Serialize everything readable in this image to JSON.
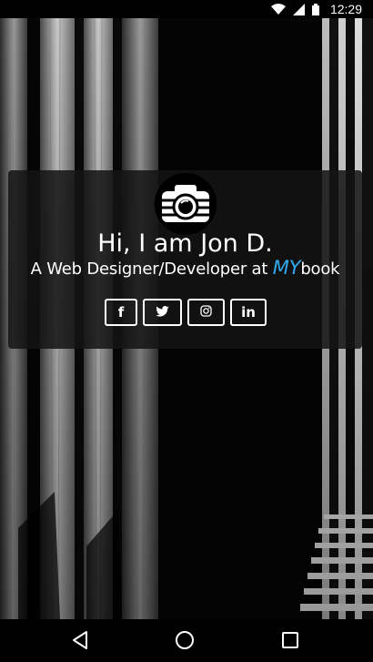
{
  "status_bar": {
    "time": "12:29",
    "icons": [
      "wifi-icon",
      "signal-icon",
      "battery-icon"
    ]
  },
  "hero": {
    "avatar_icon": "camera-icon",
    "title": "Hi, I am Jon D.",
    "subtitle_prefix": "A Web Designer/Developer at ",
    "brand_highlight": "MY",
    "brand_suffix": "book",
    "brand_color": "#33aaee"
  },
  "social": {
    "facebook": "f",
    "twitter_icon": "twitter-icon",
    "instagram_icon": "instagram-icon",
    "linkedin": "in"
  },
  "nav_bar": {
    "icons": [
      "back-icon",
      "home-icon",
      "recents-icon"
    ]
  }
}
